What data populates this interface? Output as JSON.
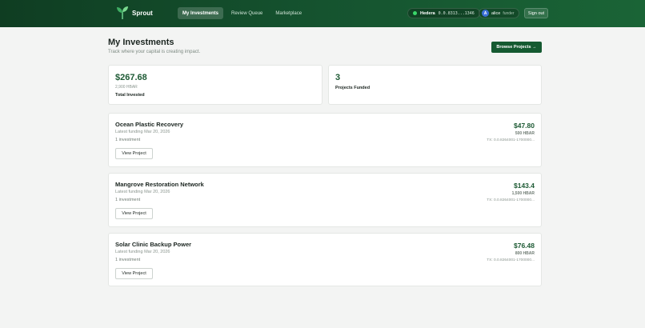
{
  "nav": {
    "brand": "Sprout",
    "tabs": [
      {
        "label": "My Investments",
        "active": true
      },
      {
        "label": "Review Queue",
        "active": false
      },
      {
        "label": "Marketplace",
        "active": false
      }
    ],
    "wallet": {
      "network": "Hedera",
      "account": "0.0.8313...1346"
    },
    "user": {
      "initial": "A",
      "name": "alice",
      "role": "funder"
    },
    "signout_label": "Sign out"
  },
  "header": {
    "title": "My Investments",
    "subtitle": "Track where your capital is creating impact.",
    "browse_label": "Browse Projects →"
  },
  "stats": {
    "total": {
      "value": "$267.68",
      "hbar": "2,900 HBAR",
      "label": "Total Invested"
    },
    "funded": {
      "value": "3",
      "label": "Projects Funded"
    }
  },
  "investments": [
    {
      "name": "Ocean Plastic Recovery",
      "date": "Latest funding Mar 20, 2026",
      "count": "1 investment",
      "amount": "$47.80",
      "hbar": "500 HBAR",
      "tx": "TX: 0.0.8264001-1700000..."
    },
    {
      "name": "Mangrove Restoration Network",
      "date": "Latest funding Mar 20, 2026",
      "count": "1 investment",
      "amount": "$143.4",
      "hbar": "1,500 HBAR",
      "tx": "TX: 0.0.8264001-1700000..."
    },
    {
      "name": "Solar Clinic Backup Power",
      "date": "Latest funding Mar 20, 2026",
      "count": "1 investment",
      "amount": "$76.48",
      "hbar": "800 HBAR",
      "tx": "TX: 0.0.8264001-1700000..."
    }
  ],
  "view_label": "View Project",
  "colors": {
    "brand_dark": "#0f3d22",
    "accent": "#155a31",
    "amount": "#1d5a34",
    "status_dot": "#3ad66a"
  }
}
